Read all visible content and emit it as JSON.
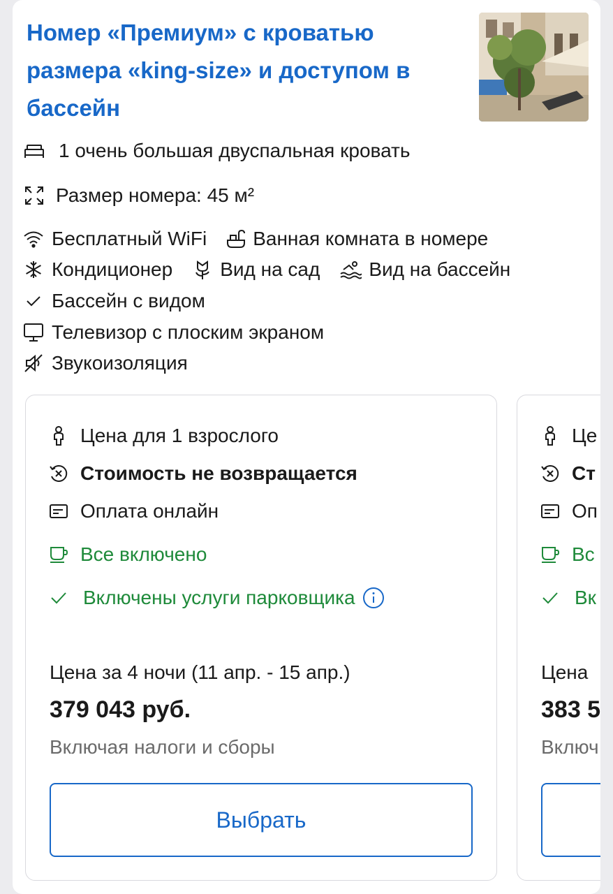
{
  "room": {
    "title": "Номер «Премиум» с кроватью размера «king-size» и доступом в бассейн",
    "bed": "1 очень большая двуспальная кровать",
    "size": "Размер номера: 45 м²",
    "amenities": {
      "wifi": "Бесплатный WiFi",
      "bathroom": "Ванная комната в номере",
      "aircon": "Кондиционер",
      "garden_view": "Вид на сад",
      "pool_view": "Вид на бассейн",
      "pool": "Бассейн с видом",
      "tv": "Телевизор с плоским экраном",
      "soundproof": "Звукоизоляция"
    }
  },
  "offers": [
    {
      "guests": "Цена для 1 взрослого",
      "refund": "Стоимость не возвращается",
      "payment": "Оплата онлайн",
      "meals": "Все включено",
      "parking": "Включены услуги парковщика",
      "price_label": "Цена за 4 ночи (11 апр. - 15 апр.)",
      "price": "379 043 руб.",
      "taxes": "Включая налоги и сборы",
      "button": "Выбрать"
    },
    {
      "guests": "Це",
      "refund": "Ст",
      "payment": "Оп",
      "meals": "Вс",
      "parking": "Вк",
      "price_label": "Цена",
      "price": "383 5",
      "taxes": "Включ",
      "button": ""
    }
  ],
  "colors": {
    "link_blue": "#1868c8",
    "green": "#1e8a3a",
    "muted": "#6b6b6b",
    "border": "#d9d9de"
  }
}
